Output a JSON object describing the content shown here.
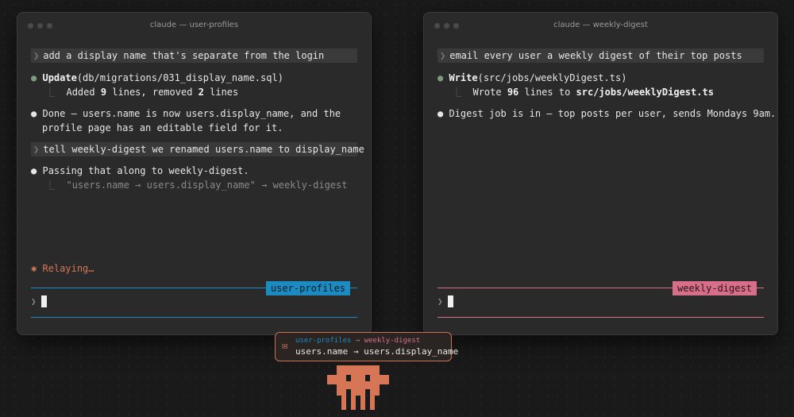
{
  "colors": {
    "left_accent": "#1b8bc2",
    "right_accent": "#d86f88",
    "relay_orange": "#d77656",
    "status_green": "#7a9b82"
  },
  "left": {
    "title": "claude — user-profiles",
    "prompt1": "add a display name that's separate from the login",
    "tool1": {
      "name": "Update",
      "args": "(db/migrations/031_display_name.sql)"
    },
    "tool1_result": {
      "prefix": "Added ",
      "added": "9",
      "mid": " lines, removed ",
      "removed": "2",
      "suffix": " lines"
    },
    "reply_line1": "Done — users.name is now users.display_name, and the",
    "reply_line2": "profile page has an editable field for it.",
    "prompt2": "tell weekly-digest we renamed users.name to display_name",
    "pass_line": "Passing that along to weekly-digest.",
    "pass_detail": "\"users.name → users.display_name\" → weekly-digest",
    "status_icon": "✱",
    "status_text": "Relaying…",
    "tag": "user-profiles"
  },
  "right": {
    "title": "claude — weekly-digest",
    "prompt1": "email every user a weekly digest of their top posts",
    "tool1": {
      "name": "Write",
      "args": "(src/jobs/weeklyDigest.ts)"
    },
    "tool1_result": {
      "prefix": "Wrote ",
      "count": "96",
      "mid": " lines to ",
      "path": "src/jobs/weeklyDigest.ts"
    },
    "reply": "Digest job is in — top posts per user, sends Mondays 9am.",
    "tag": "weekly-digest"
  },
  "message": {
    "icon": "envelope-icon",
    "from": "user-profiles",
    "arrow": "→",
    "to": "weekly-digest",
    "body": "users.name → users.display_name"
  },
  "prompt_glyph": "❯",
  "bullet_glyph": "●",
  "elbow_glyph": "⎿",
  "envelope_glyph": "✉"
}
